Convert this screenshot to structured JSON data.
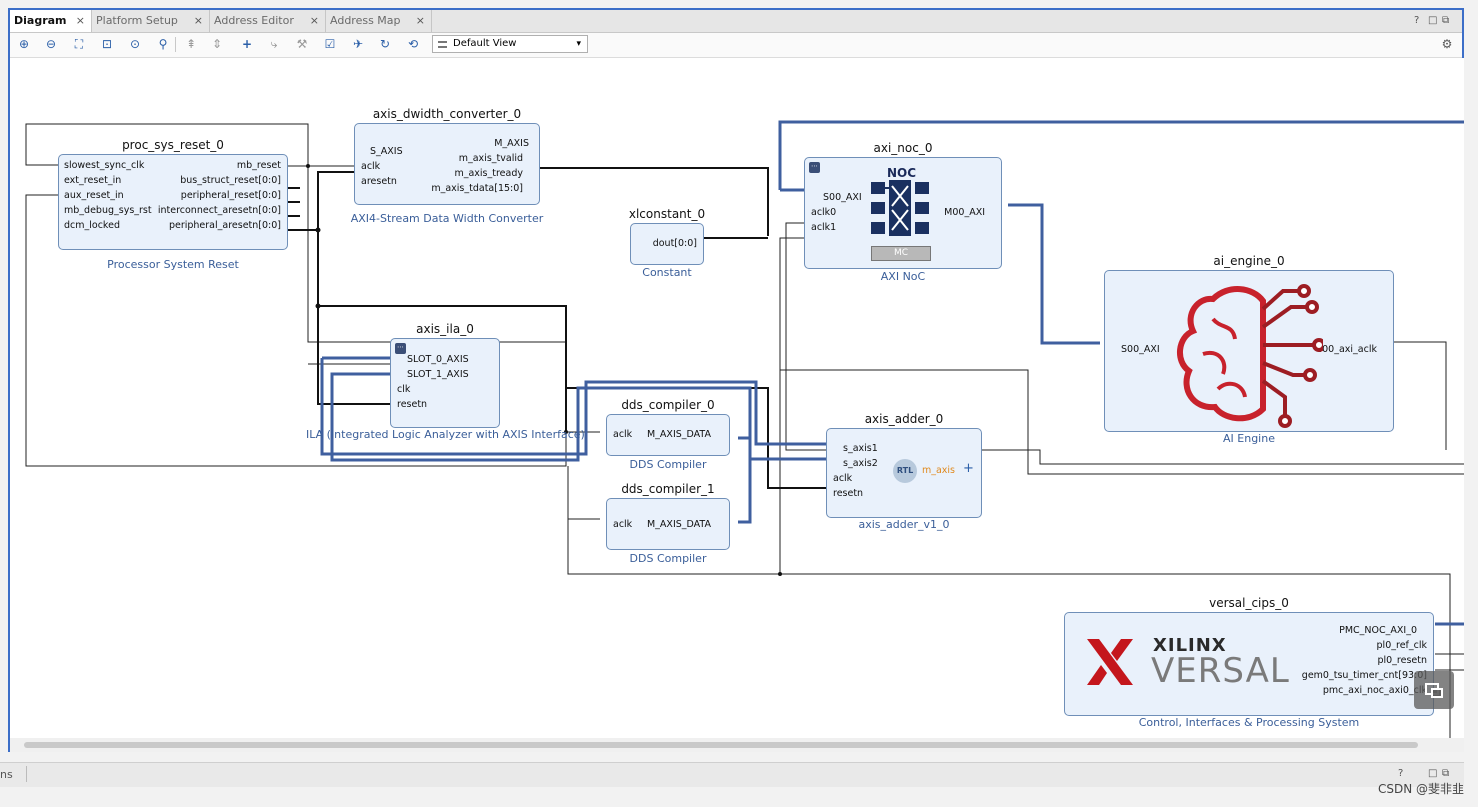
{
  "tabs": [
    {
      "label": "Diagram"
    },
    {
      "label": "Platform Setup"
    },
    {
      "label": "Address Editor"
    },
    {
      "label": "Address Map"
    }
  ],
  "window_controls": {
    "help": "?",
    "restore": "□",
    "maximize": "⧉"
  },
  "toolbar": {
    "view_select": "Default View",
    "icons": [
      "zoom-in-icon",
      "zoom-out-icon",
      "zoom-fit-icon",
      "fit-selection-icon",
      "auto-fit-icon",
      "search-icon",
      "collapse-all-icon",
      "expand-all-icon",
      "add-ip-icon",
      "add-module-icon",
      "wrench-icon",
      "validate-icon",
      "run-automation-icon",
      "refresh-icon",
      "regenerate-layout-icon"
    ]
  },
  "blocks": {
    "proc_sys_reset": {
      "name": "proc_sys_reset_0",
      "subtitle": "Processor System Reset",
      "left_pins": [
        "slowest_sync_clk",
        "ext_reset_in",
        "aux_reset_in",
        "mb_debug_sys_rst",
        "dcm_locked"
      ],
      "right_pins": [
        "mb_reset",
        "bus_struct_reset[0:0]",
        "peripheral_reset[0:0]",
        "interconnect_aresetn[0:0]",
        "peripheral_aresetn[0:0]"
      ]
    },
    "axis_dwidth": {
      "name": "axis_dwidth_converter_0",
      "subtitle": "AXI4-Stream Data Width Converter",
      "left_pins": [
        "S_AXIS",
        "aclk",
        "aresetn"
      ],
      "right_pins": [
        "M_AXIS",
        "m_axis_tvalid",
        "m_axis_tready",
        "m_axis_tdata[15:0]"
      ]
    },
    "xlconstant": {
      "name": "xlconstant_0",
      "subtitle": "Constant",
      "right_pins": [
        "dout[0:0]"
      ]
    },
    "axi_noc": {
      "name": "axi_noc_0",
      "subtitle": "AXI NoC",
      "logo_text": "NOC",
      "mc_text": "MC",
      "left_pins": [
        "S00_AXI",
        "aclk0",
        "aclk1"
      ],
      "right_pins": [
        "M00_AXI"
      ]
    },
    "ai_engine": {
      "name": "ai_engine_0",
      "subtitle": "AI Engine",
      "left_pins": [
        "S00_AXI"
      ],
      "right_pins": [
        "s00_axi_aclk"
      ]
    },
    "axis_ila": {
      "name": "axis_ila_0",
      "subtitle": "ILA (Integrated Logic Analyzer with AXIS Interface)",
      "left_pins": [
        "SLOT_0_AXIS",
        "SLOT_1_AXIS",
        "clk",
        "resetn"
      ]
    },
    "dds0": {
      "name": "dds_compiler_0",
      "subtitle": "DDS Compiler",
      "left_pins": [
        "aclk"
      ],
      "right_pins": [
        "M_AXIS_DATA"
      ]
    },
    "dds1": {
      "name": "dds_compiler_1",
      "subtitle": "DDS Compiler",
      "left_pins": [
        "aclk"
      ],
      "right_pins": [
        "M_AXIS_DATA"
      ]
    },
    "axis_adder": {
      "name": "axis_adder_0",
      "subtitle": "axis_adder_v1_0",
      "badge": "RTL",
      "left_pins": [
        "s_axis1",
        "s_axis2",
        "aclk",
        "resetn"
      ],
      "right_pins": [
        "m_axis"
      ]
    },
    "versal_cips": {
      "name": "versal_cips_0",
      "subtitle": "Control, Interfaces & Processing System",
      "logo_top": "XILINX",
      "logo_bottom": "VERSAL",
      "right_pins": [
        "PMC_NOC_AXI_0",
        "pl0_ref_clk",
        "pl0_resetn",
        "gem0_tsu_timer_cnt[93:0]",
        "pmc_axi_noc_axi0_clk"
      ]
    }
  },
  "bottom_panel": {
    "tab_fragment": "ns"
  },
  "watermark": "CSDN @斐非韭",
  "colors": {
    "accent": "#3c6ec8",
    "block_fill": "#e9f1fb",
    "bus": "#3f5f9f",
    "ai_red": "#c8222c"
  }
}
